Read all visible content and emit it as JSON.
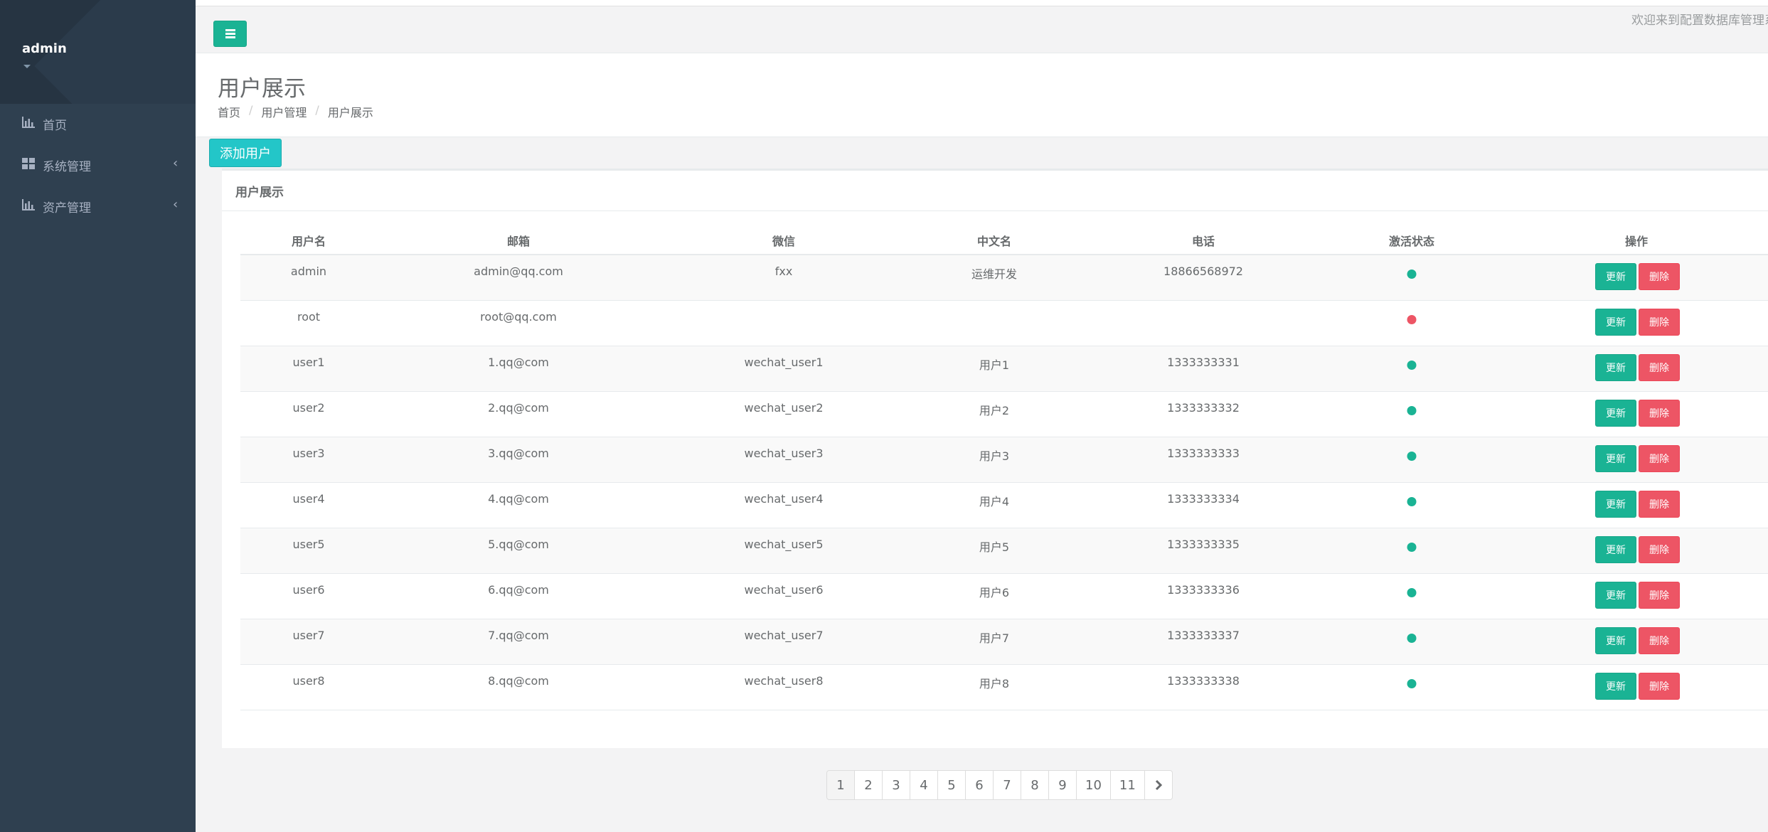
{
  "sidebar": {
    "username": "admin",
    "items": [
      {
        "label": "首页",
        "icon": "bar-chart-icon",
        "has_arrow": false
      },
      {
        "label": "系统管理",
        "icon": "grid-icon",
        "has_arrow": true
      },
      {
        "label": "资产管理",
        "icon": "bar-chart-icon",
        "has_arrow": true
      }
    ],
    "arrow_glyph": "‹"
  },
  "header": {
    "welcome_text": "欢迎来到配置数据库管理系"
  },
  "page": {
    "title": "用户展示",
    "breadcrumb": [
      "首页",
      "用户管理",
      "用户展示"
    ],
    "add_button_label": "添加用户"
  },
  "card": {
    "title": "用户展示"
  },
  "table": {
    "columns": [
      "用户名",
      "邮箱",
      "微信",
      "中文名",
      "电话",
      "激活状态",
      "操作"
    ],
    "update_label": "更新",
    "delete_label": "删除",
    "rows": [
      {
        "username": "admin",
        "email": "admin@qq.com",
        "wechat": "fxx",
        "cn_name": "运维开发",
        "phone": "18866568972",
        "active": true
      },
      {
        "username": "root",
        "email": "root@qq.com",
        "wechat": "",
        "cn_name": "",
        "phone": "",
        "active": false
      },
      {
        "username": "user1",
        "email": "1.qq@com",
        "wechat": "wechat_user1",
        "cn_name": "用户1",
        "phone": "1333333331",
        "active": true
      },
      {
        "username": "user2",
        "email": "2.qq@com",
        "wechat": "wechat_user2",
        "cn_name": "用户2",
        "phone": "1333333332",
        "active": true
      },
      {
        "username": "user3",
        "email": "3.qq@com",
        "wechat": "wechat_user3",
        "cn_name": "用户3",
        "phone": "1333333333",
        "active": true
      },
      {
        "username": "user4",
        "email": "4.qq@com",
        "wechat": "wechat_user4",
        "cn_name": "用户4",
        "phone": "1333333334",
        "active": true
      },
      {
        "username": "user5",
        "email": "5.qq@com",
        "wechat": "wechat_user5",
        "cn_name": "用户5",
        "phone": "1333333335",
        "active": true
      },
      {
        "username": "user6",
        "email": "6.qq@com",
        "wechat": "wechat_user6",
        "cn_name": "用户6",
        "phone": "1333333336",
        "active": true
      },
      {
        "username": "user7",
        "email": "7.qq@com",
        "wechat": "wechat_user7",
        "cn_name": "用户7",
        "phone": "1333333337",
        "active": true
      },
      {
        "username": "user8",
        "email": "8.qq@com",
        "wechat": "wechat_user8",
        "cn_name": "用户8",
        "phone": "1333333338",
        "active": true
      }
    ]
  },
  "pagination": {
    "pages": [
      "1",
      "2",
      "3",
      "4",
      "5",
      "6",
      "7",
      "8",
      "9",
      "10",
      "11"
    ],
    "current": "1",
    "next_icon": "chevron-right-icon"
  },
  "colors": {
    "sidebar_bg": "#2f4050",
    "primary": "#1ab394",
    "info": "#23c6c8",
    "danger": "#ed5565",
    "active_dot": "#1ab394",
    "inactive_dot": "#ed5565"
  }
}
